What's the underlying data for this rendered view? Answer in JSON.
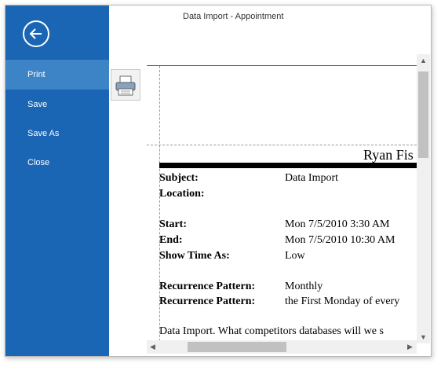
{
  "window": {
    "title": "Data Import - Appointment"
  },
  "sidebar": {
    "back_icon": "arrow-left-circle-icon",
    "items": [
      {
        "label": "Print",
        "selected": true
      },
      {
        "label": "Save"
      },
      {
        "label": "Save As"
      },
      {
        "label": "Close"
      }
    ]
  },
  "toolbar": {
    "print_icon": "printer-icon"
  },
  "document": {
    "header_name": "Ryan Fis",
    "fields": [
      {
        "label": "Subject:",
        "value": "Data Import"
      },
      {
        "label": "Location:",
        "value": ""
      },
      {
        "label": "Start:",
        "value": "Mon 7/5/2010 3:30 AM"
      },
      {
        "label": "End:",
        "value": "Mon 7/5/2010 10:30 AM"
      },
      {
        "label": "Show Time As:",
        "value": "Low"
      },
      {
        "label": "Recurrence Pattern:",
        "value": "Monthly"
      },
      {
        "label": "Recurrence Pattern:",
        "value": "the First Monday of every"
      }
    ],
    "description": "Data Import. What competitors databases will we s"
  },
  "colors": {
    "sidebar": "#1a66b5",
    "selected": "#3d84c7"
  }
}
